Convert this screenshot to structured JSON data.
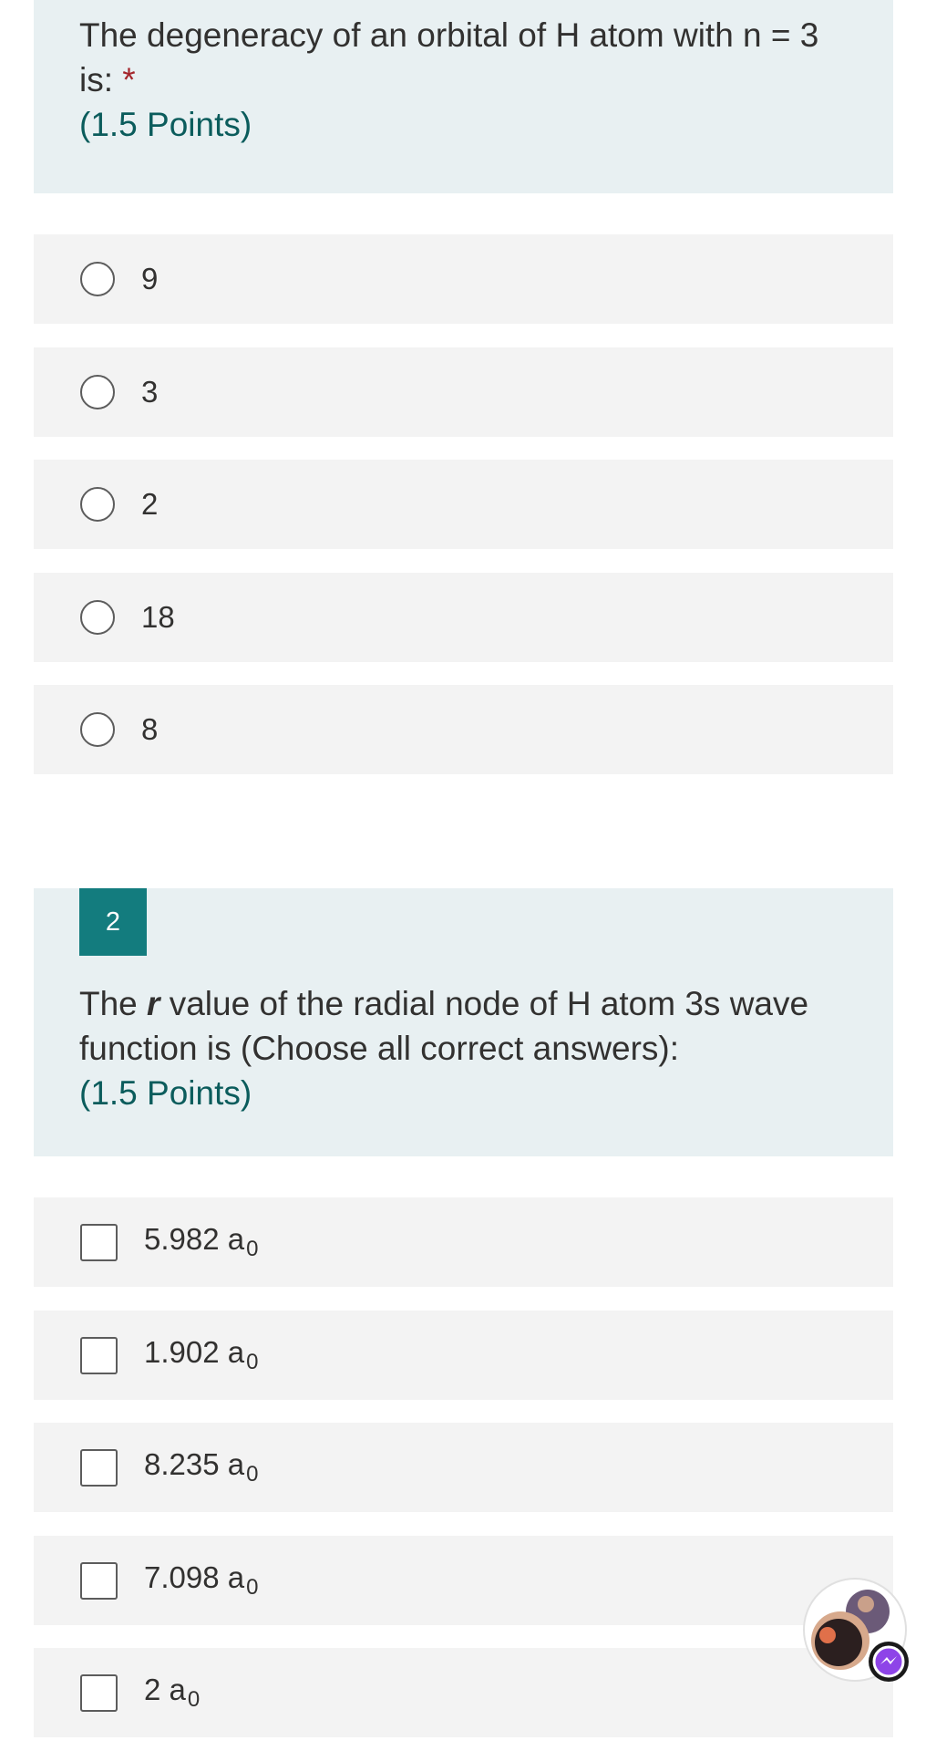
{
  "question1": {
    "title": "The degeneracy of an orbital of H atom with n = 3 is:",
    "required_marker": "*",
    "points": "(1.5 Points)",
    "options": [
      "9",
      "3",
      "2",
      "18",
      "8"
    ]
  },
  "question2": {
    "number": "2",
    "title_pre": "The ",
    "title_var": "r",
    "title_post": " value of the radial node of H atom 3s wave function is (Choose all correct answers):",
    "points": "(1.5 Points)",
    "options": [
      {
        "value": "5.982 a",
        "unit_sub": "0"
      },
      {
        "value": "1.902 a",
        "unit_sub": "0"
      },
      {
        "value": "8.235 a",
        "unit_sub": "0"
      },
      {
        "value": "7.098 a",
        "unit_sub": "0"
      },
      {
        "value": "2 a",
        "unit_sub": "0"
      }
    ]
  },
  "colors": {
    "header_bg": "#e8f0f2",
    "option_bg": "#f3f3f3",
    "accent": "#137c7e",
    "points_text": "#0b5c5c",
    "required": "#a4262c"
  },
  "icons": {
    "radio": "radio-button-icon",
    "checkbox": "checkbox-icon",
    "chat_head": "messenger-chat-head-icon"
  }
}
